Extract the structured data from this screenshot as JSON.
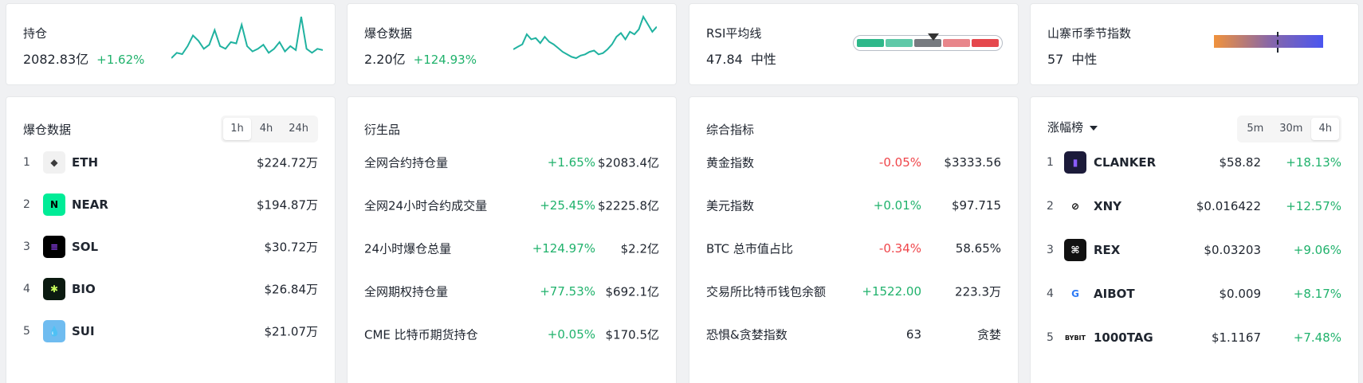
{
  "open_interest": {
    "label": "持仓",
    "value": "2082.83亿",
    "change": "+1.62%",
    "spark": [
      5,
      9,
      8,
      14,
      22,
      18,
      12,
      15,
      26,
      14,
      12,
      17,
      16,
      30,
      14,
      10,
      12,
      15,
      9,
      12,
      17,
      10,
      14,
      11,
      36,
      12,
      9,
      12,
      11
    ]
  },
  "liquidation": {
    "label": "爆仓数据",
    "value": "2.20亿",
    "change": "+124.93%",
    "spark": [
      12,
      14,
      16,
      24,
      20,
      21,
      17,
      22,
      18,
      16,
      13,
      10,
      8,
      6,
      5,
      7,
      8,
      10,
      11,
      8,
      9,
      12,
      16,
      22,
      25,
      20,
      26,
      24,
      28,
      38,
      32,
      26,
      30
    ]
  },
  "rsi": {
    "label": "RSI平均线",
    "value": "47.84",
    "status": "中性",
    "colors": [
      "#2eb88a",
      "#5fc9a8",
      "#777b80",
      "#e8868b",
      "#e5484d"
    ]
  },
  "altseason": {
    "label": "山寨币季节指数",
    "value": "57",
    "status": "中性"
  },
  "liq_panel": {
    "title": "爆仓数据",
    "tabs": [
      "1h",
      "4h",
      "24h"
    ],
    "active_tab": "1h",
    "rows": [
      {
        "rank": "1",
        "symbol": "ETH",
        "value": "$224.72万",
        "icon_color": "#f1f1f1",
        "icon_glyph": "◆",
        "glyph_color": "#3c3c3d"
      },
      {
        "rank": "2",
        "symbol": "NEAR",
        "value": "$194.87万",
        "icon_color": "#00ec97",
        "icon_glyph": "N",
        "glyph_color": "#000000"
      },
      {
        "rank": "3",
        "symbol": "SOL",
        "value": "$30.72万",
        "icon_color": "#000000",
        "icon_glyph": "≡",
        "glyph_color": "#9945ff"
      },
      {
        "rank": "4",
        "symbol": "BIO",
        "value": "$26.84万",
        "icon_color": "#0b1a10",
        "icon_glyph": "✱",
        "glyph_color": "#c8ff5c"
      },
      {
        "rank": "5",
        "symbol": "SUI",
        "value": "$21.07万",
        "icon_color": "#6fbcf0",
        "icon_glyph": "💧",
        "glyph_color": "#ffffff"
      }
    ]
  },
  "derivatives": {
    "title": "衍生品",
    "rows": [
      {
        "name": "全网合约持仓量",
        "change": "+1.65%",
        "value": "$2083.4亿"
      },
      {
        "name": "全网24小时合约成交量",
        "change": "+25.45%",
        "value": "$2225.8亿"
      },
      {
        "name": "24小时爆仓总量",
        "change": "+124.97%",
        "value": "$2.2亿"
      },
      {
        "name": "全网期权持仓量",
        "change": "+77.53%",
        "value": "$692.1亿"
      },
      {
        "name": "CME 比特币期货持仓",
        "change": "+0.05%",
        "value": "$170.5亿"
      }
    ]
  },
  "indicators": {
    "title": "综合指标",
    "rows": [
      {
        "name": "黄金指数",
        "change": "-0.05%",
        "value": "$3333.56",
        "dir": "down"
      },
      {
        "name": "美元指数",
        "change": "+0.01%",
        "value": "$97.715",
        "dir": "up"
      },
      {
        "name": "BTC 总市值占比",
        "change": "-0.34%",
        "value": "58.65%",
        "dir": "down"
      },
      {
        "name": "交易所比特币钱包余额",
        "change": "+1522.00",
        "value": "223.3万",
        "dir": "up"
      },
      {
        "name": "恐惧&贪婪指数",
        "change": "63",
        "value": "贪婪",
        "dir": "neutral"
      }
    ]
  },
  "gainers": {
    "title": "涨幅榜",
    "tabs": [
      "5m",
      "30m",
      "4h"
    ],
    "active_tab": "4h",
    "rows": [
      {
        "rank": "1",
        "symbol": "CLANKER",
        "price": "$58.82",
        "change": "+18.13%",
        "icon_color": "#1c1b3a",
        "icon_glyph": "▮",
        "glyph_color": "#8a5cff"
      },
      {
        "rank": "2",
        "symbol": "XNY",
        "price": "$0.016422",
        "change": "+12.57%",
        "icon_color": "#ffffff",
        "icon_glyph": "⊘",
        "glyph_color": "#000000"
      },
      {
        "rank": "3",
        "symbol": "REX",
        "price": "$0.03203",
        "change": "+9.06%",
        "icon_color": "#111111",
        "icon_glyph": "⌘",
        "glyph_color": "#ffffff"
      },
      {
        "rank": "4",
        "symbol": "AIBOT",
        "price": "$0.009",
        "change": "+8.17%",
        "icon_color": "#ffffff",
        "icon_glyph": "G",
        "glyph_color": "#2f7bf5"
      },
      {
        "rank": "5",
        "symbol": "1000TAG",
        "price": "$1.1167",
        "change": "+7.48%",
        "icon_color": "#ffffff",
        "icon_glyph": "BYBIT",
        "glyph_color": "#111111"
      }
    ]
  }
}
